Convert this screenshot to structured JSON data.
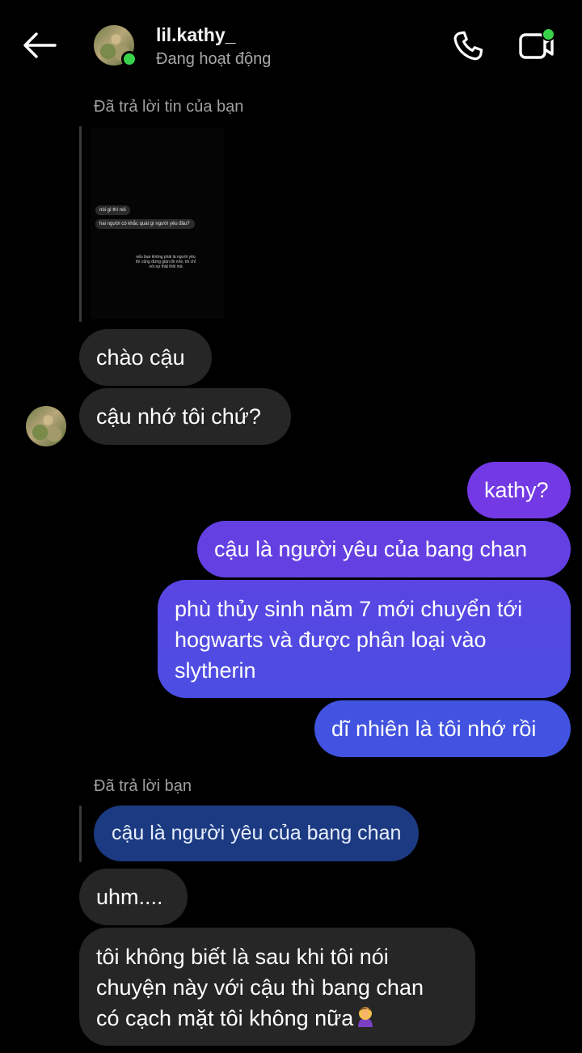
{
  "header": {
    "username": "lil.kathy_",
    "status": "Đang hoạt động",
    "back_icon": "arrow-left-icon",
    "call_icon": "phone-icon",
    "video_icon": "video-camera-icon"
  },
  "colors": {
    "background": "#000000",
    "received_bubble": "#262626",
    "sent_gradient_top": "#7a3ee6",
    "sent_gradient_bottom": "#3f55e0",
    "quote_bubble": "#1b3a82",
    "online": "#38d34a"
  },
  "story_reply": {
    "label": "Đã trả lời tin của bạn",
    "thumb": {
      "bubble1": "nói gì thì nói",
      "bubble2": "hai người có khắc quái gì người yêu đâu?",
      "caption": "nếu bạn không phải là người yêu thì cũng đừng giận tôi nhé, tôi chỉ nói sự thật thôi mà"
    }
  },
  "messages": [
    {
      "side": "received",
      "text": "chào cậu"
    },
    {
      "side": "received",
      "text": "cậu nhớ tôi chứ?"
    },
    {
      "side": "sent",
      "text": "kathy?"
    },
    {
      "side": "sent",
      "text": "cậu là người yêu của bang chan"
    },
    {
      "side": "sent",
      "text": "phù thủy sinh năm 7 mới chuyển tới hogwarts và được phân loại vào slytherin"
    },
    {
      "side": "sent",
      "text": "dĩ nhiên là tôi nhớ rồi"
    }
  ],
  "message_reply": {
    "label": "Đã trả lời bạn",
    "quoted_text": "cậu là người yêu của bang chan"
  },
  "replies": [
    {
      "side": "received",
      "text": "uhm...."
    },
    {
      "side": "received",
      "text": "tôi không biết là sau khi tôi nói chuyện này với cậu thì bang chan có cạch mặt tôi không nữa",
      "emoji": "woman-facepalming"
    }
  ]
}
